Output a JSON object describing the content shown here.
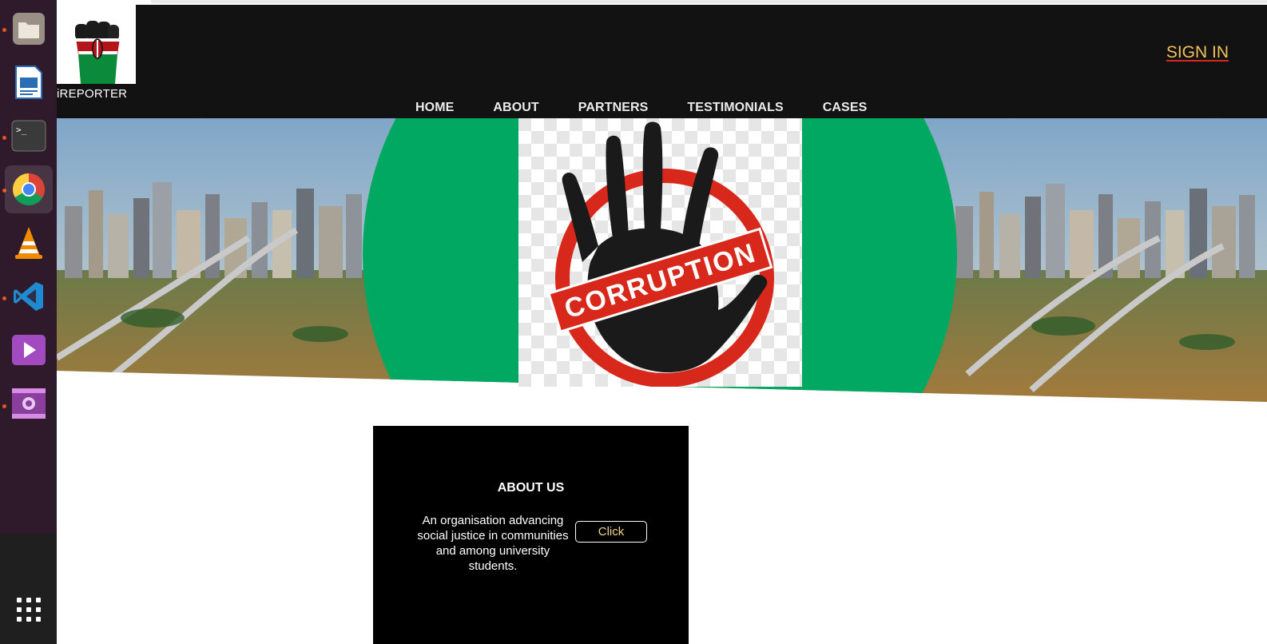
{
  "dock": {
    "items": [
      {
        "name": "files-icon",
        "running": true
      },
      {
        "name": "libreoffice-impress-icon",
        "running": false
      },
      {
        "name": "terminal-icon",
        "running": true
      },
      {
        "name": "chrome-icon",
        "running": true,
        "active": true
      },
      {
        "name": "vlc-icon",
        "running": false
      },
      {
        "name": "vscode-icon",
        "running": true
      },
      {
        "name": "media-player-icon",
        "running": false
      },
      {
        "name": "video-editor-icon",
        "running": true
      }
    ],
    "apps_grid": "show-applications-icon",
    "terminal_prompt": ">_"
  },
  "site": {
    "name": "iREPORTER",
    "sign_in": "SIGN IN",
    "nav": [
      "HOME",
      "ABOUT",
      "PARTNERS",
      "TESTIMONIALS",
      "CASES"
    ]
  },
  "hero": {
    "banner_text": "CORRUPTION"
  },
  "about": {
    "title": "ABOUT US",
    "text": "An organisation advancing social justice in communities and among university students.",
    "button": "Click"
  },
  "colors": {
    "header_bg": "#121212",
    "sign_in": "#f2c15c",
    "hero_green": "#00a862",
    "stamp_red": "#d8281b",
    "dock_bg": "#2e1a2a"
  }
}
